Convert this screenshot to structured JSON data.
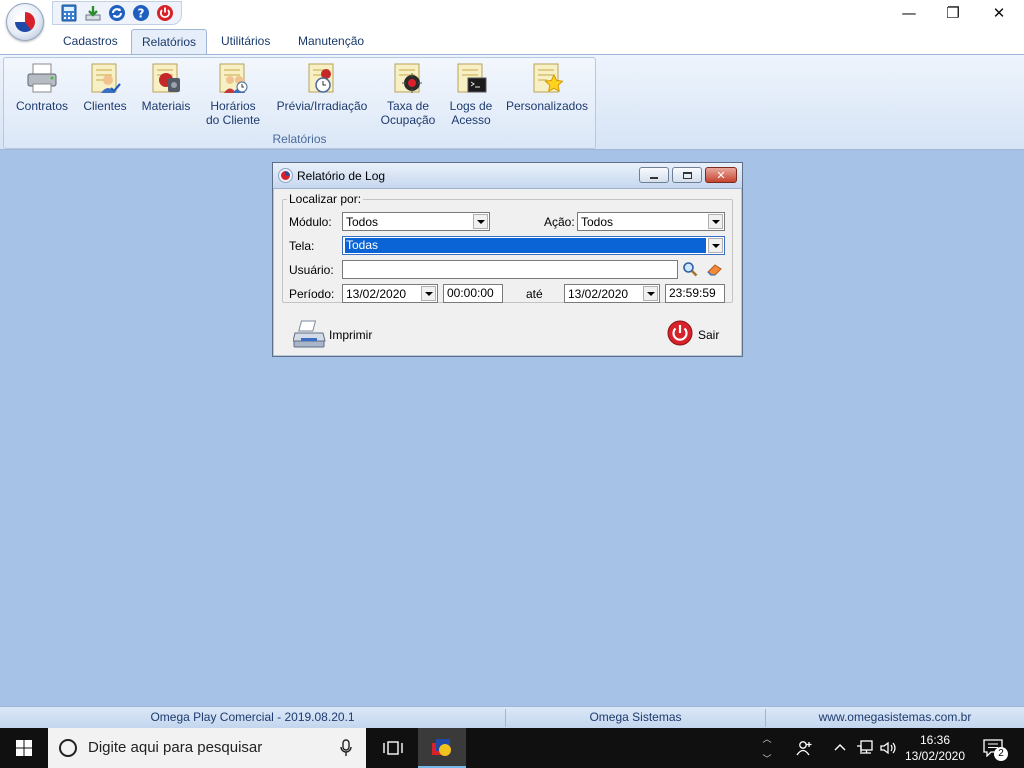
{
  "window": {
    "minimize_glyph": "—",
    "restore_glyph": "❐",
    "close_glyph": "✕"
  },
  "quick_access": [
    {
      "name": "calculator-icon"
    },
    {
      "name": "download-icon"
    },
    {
      "name": "refresh-icon"
    },
    {
      "name": "help-icon"
    },
    {
      "name": "power-icon"
    }
  ],
  "ribbon": {
    "tabs": [
      {
        "label": "Cadastros"
      },
      {
        "label": "Relatórios",
        "active": true
      },
      {
        "label": "Utilitários"
      },
      {
        "label": "Manutenção"
      }
    ],
    "buttons": [
      {
        "line1": "Contratos",
        "line2": "",
        "icon": "printer-report-icon"
      },
      {
        "line1": "Clientes",
        "line2": "",
        "icon": "clients-report-icon"
      },
      {
        "line1": "Materiais",
        "line2": "",
        "icon": "materials-report-icon"
      },
      {
        "line1": "Horários",
        "line2": "do Cliente",
        "icon": "schedule-report-icon"
      },
      {
        "line1": "Prévia/Irradiação",
        "line2": "",
        "icon": "preview-report-icon"
      },
      {
        "line1": "Taxa de",
        "line2": "Ocupação",
        "icon": "occupancy-report-icon"
      },
      {
        "line1": "Logs de",
        "line2": "Acesso",
        "icon": "access-log-report-icon"
      },
      {
        "line1": "Personalizados",
        "line2": "",
        "icon": "custom-report-icon"
      }
    ],
    "group_label": "Relatórios"
  },
  "dialog": {
    "title": "Relatório de Log",
    "legend": "Localizar por:",
    "modulo": {
      "label": "Módulo:",
      "value": "Todos"
    },
    "acao": {
      "label": "Ação:",
      "value": "Todos"
    },
    "tela": {
      "label": "Tela:",
      "value": "Todas"
    },
    "usuario": {
      "label": "Usuário:",
      "value": ""
    },
    "periodo": {
      "label": "Período:",
      "start_date": "13/02/2020",
      "start_time": "00:00:00",
      "sep": "até",
      "end_date": "13/02/2020",
      "end_time": "23:59:59"
    },
    "print_label": "Imprimir",
    "exit_label": "Sair"
  },
  "statusbar": {
    "product": "Omega Play Comercial - 2019.08.20.1",
    "company": "Omega Sistemas",
    "website": "www.omegasistemas.com.br"
  },
  "taskbar": {
    "search_placeholder": "Digite aqui para pesquisar",
    "time": "16:36",
    "date": "13/02/2020",
    "notification_count": "2"
  },
  "colors": {
    "desktop_bg": "#a6c2e6",
    "ribbon_text": "#1e3b6e",
    "selection_blue": "#0a64d6",
    "exit_red": "#d8222a"
  }
}
